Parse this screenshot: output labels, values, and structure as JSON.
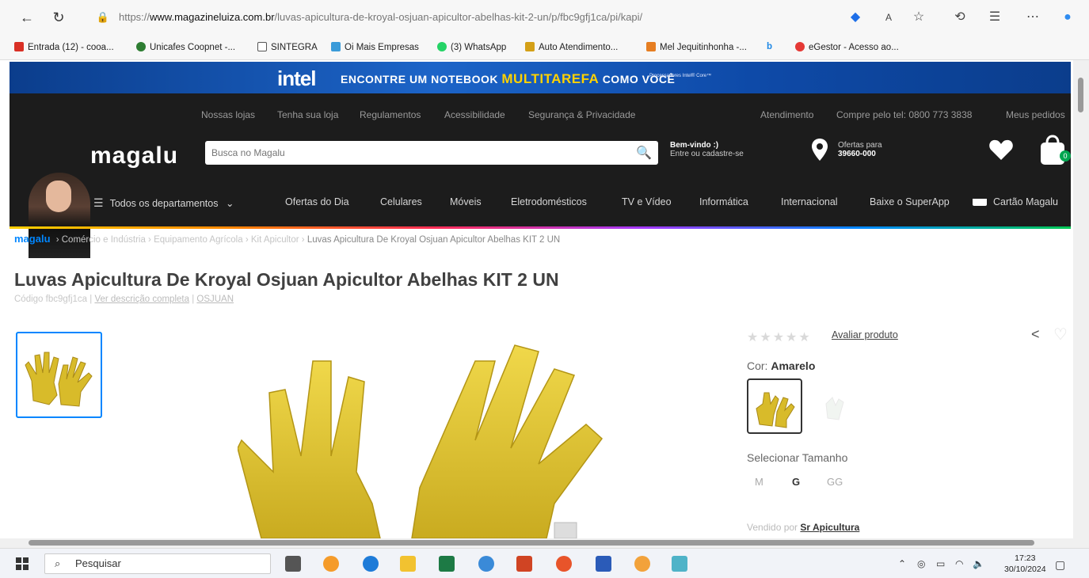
{
  "browser": {
    "url_prefix": "https://",
    "url_domain": "www.magazineluiza.com.br",
    "url_path": "/luvas-apicultura-de-kroyal-osjuan-apicultor-abelhas-kit-2-un/p/fbc9gfj1ca/pi/kapi/"
  },
  "bookmarks": [
    {
      "label": "Entrada (12) - cooa...",
      "color": "#d93025"
    },
    {
      "label": "Unicafes Coopnet -...",
      "color": "#2e7d32"
    },
    {
      "label": "SINTEGRA",
      "color": "#555555"
    },
    {
      "label": "Oi Mais Empresas",
      "color": "#3a9bd9"
    },
    {
      "label": "(3) WhatsApp",
      "color": "#25d366"
    },
    {
      "label": "Auto Atendimento...",
      "color": "#d4a017"
    },
    {
      "label": "Mel Jequitinhonha -...",
      "color": "#e67e22"
    },
    {
      "label": "b",
      "color": "#1e88e5"
    },
    {
      "label": "eGestor - Acesso ao...",
      "color": "#e53935"
    }
  ],
  "promo": {
    "brand": "intel",
    "text_a": "ENCONTRE UM NOTEBOOK",
    "text_b": "MULTITAREFA",
    "text_c": "COMO VOCÊ",
    "sub": "Processadores Intel® Core™"
  },
  "header": {
    "top_links": [
      "Nossas lojas",
      "Tenha sua loja",
      "Regulamentos",
      "Acessibilidade",
      "Segurança & Privacidade",
      "Atendimento",
      "Compre pelo tel: 0800 773 3838",
      "Meus pedidos"
    ],
    "logo": "magalu",
    "search_placeholder": "Busca no Magalu",
    "welcome_title": "Bem-vindo :)",
    "welcome_sub": "Entre ou cadastre-se",
    "offers_title": "Ofertas para",
    "offers_cep": "39660-000",
    "cart_count": "0",
    "menu": [
      "Todos os departamentos",
      "Ofertas do Dia",
      "Celulares",
      "Móveis",
      "Eletrodomésticos",
      "TV e Vídeo",
      "Informática",
      "Internacional",
      "Baixe o SuperApp",
      "Cartão Magalu"
    ]
  },
  "breadcrumb": {
    "home": "magalu",
    "items": [
      "Comércio e Indústria",
      "Equipamento Agrícola",
      "Kit Apicultor"
    ],
    "current": "Luvas Apicultura De Kroyal Osjuan Apicultor Abelhas KIT 2 UN"
  },
  "product": {
    "title": "Luvas Apicultura De Kroyal Osjuan Apicultor Abelhas KIT 2 UN",
    "code": "Código fbc9gfj1ca",
    "description_link": "Ver descrição completa",
    "brand": "OSJUAN",
    "rate_link": "Avaliar produto",
    "rating": 0,
    "color_label": "Cor:",
    "color_value": "Amarelo",
    "size_label": "Selecionar Tamanho",
    "sizes": [
      "M",
      "G",
      "GG"
    ],
    "selected_size": "G",
    "sold_by_label": "Vendido por",
    "seller": "Sr Apicultura"
  },
  "taskbar": {
    "search_placeholder": "Pesquisar",
    "time": "17:23",
    "date": "30/10/2024"
  }
}
